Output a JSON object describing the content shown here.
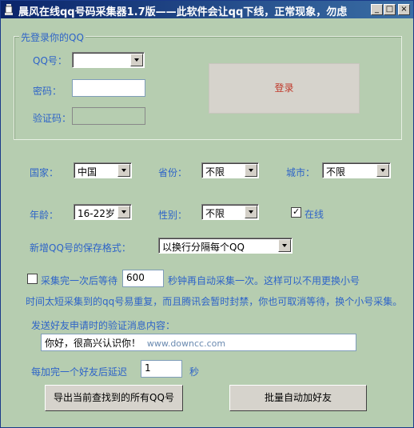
{
  "window": {
    "title": "晨风在线qq号码采集器1.7版——此软件会让qq下线，正常现象，勿虑",
    "min": "_",
    "max": "□",
    "close": "×"
  },
  "login": {
    "group_label": "先登录你的QQ",
    "qq_label": "QQ号：",
    "qq_value": "",
    "password_label": "密码：",
    "password_value": "",
    "captcha_label": "验证码：",
    "captcha_value": "",
    "login_button": "登录",
    "login_button_color": "#c0392b"
  },
  "filters": {
    "country_label": "国家：",
    "country_value": "中国",
    "province_label": "省份：",
    "province_value": "不限",
    "city_label": "城市：",
    "city_value": "不限",
    "age_label": "年龄：",
    "age_value": "16-22岁",
    "gender_label": "性别：",
    "gender_value": "不限",
    "online_label": "在线",
    "online_checked": true
  },
  "save_format": {
    "label": "新增QQ号的保存格式：",
    "value": "以换行分隔每个QQ"
  },
  "wait": {
    "checkbox_checked": false,
    "prefix": "采集完一次后等待",
    "value": "600",
    "suffix": "秒钟再自动采集一次。这样可以不用更换小号",
    "line2": "时间太短采集到的qq号易重复，而且腾讯会暂时封禁，你也可取消等待，换个小号采集。"
  },
  "message": {
    "label": "发送好友申请时的验证消息内容：",
    "value": "你好，很高兴认识你！",
    "watermark": "www.downcc.com"
  },
  "delay": {
    "prefix": "每加完一个好友后延迟",
    "value": "1",
    "suffix": "秒"
  },
  "actions": {
    "export_button": "导出当前查找到的所有QQ号",
    "add_friends_button": "批量自动加好友"
  },
  "colors": {
    "background": "#b6cdb0",
    "label_blue": "#2e64c8",
    "title_bar": "#0a246a"
  }
}
